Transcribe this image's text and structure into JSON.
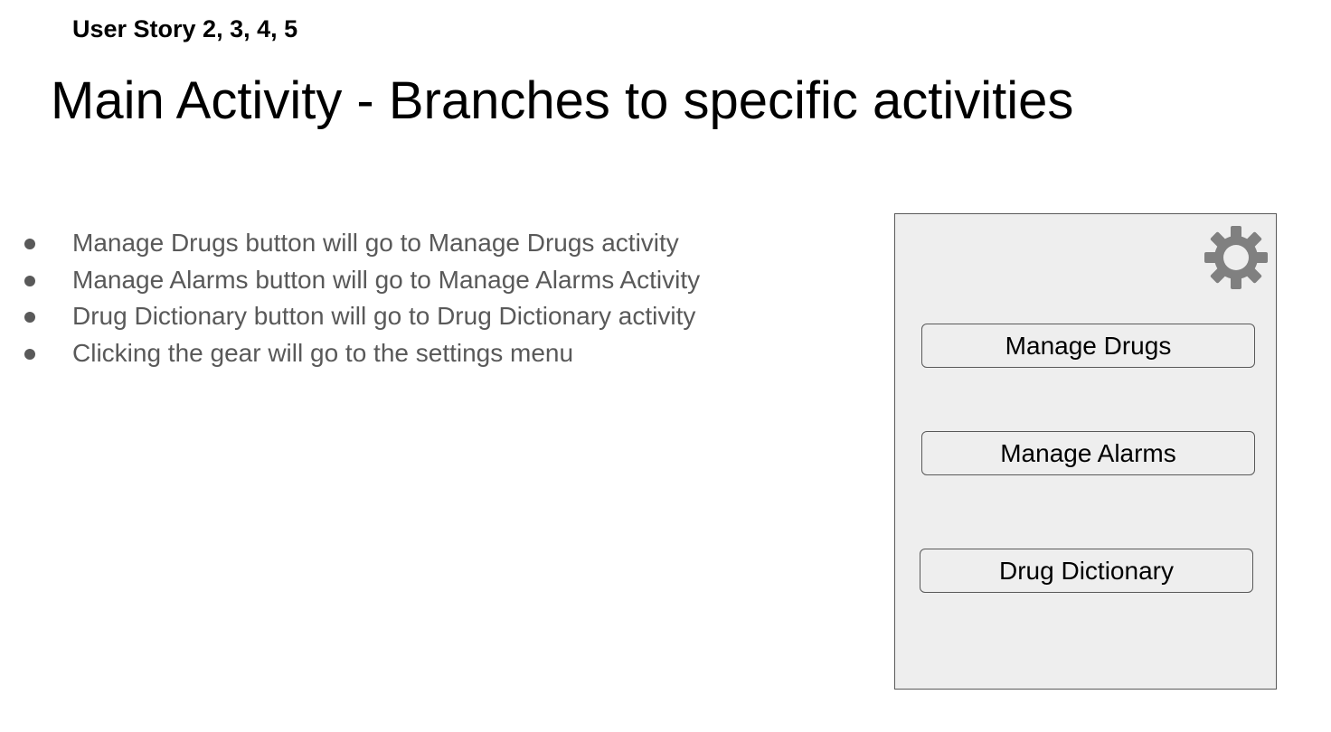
{
  "header": {
    "subtitle": "User Story 2, 3, 4, 5",
    "title": "Main Activity - Branches to specific activities"
  },
  "bullets": [
    "Manage Drugs button will go to Manage Drugs activity",
    "Manage Alarms button will go to Manage Alarms Activity",
    "Drug Dictionary button will go to Drug Dictionary activity",
    "Clicking the gear will go to the settings menu"
  ],
  "mockup": {
    "settings_icon": "gear-icon",
    "buttons": {
      "manage_drugs": "Manage Drugs",
      "manage_alarms": "Manage Alarms",
      "drug_dictionary": "Drug Dictionary"
    }
  },
  "colors": {
    "text_primary": "#000000",
    "text_secondary": "#595959",
    "mock_background": "#eeeeee",
    "mock_border": "#595959",
    "gear": "#808080"
  }
}
